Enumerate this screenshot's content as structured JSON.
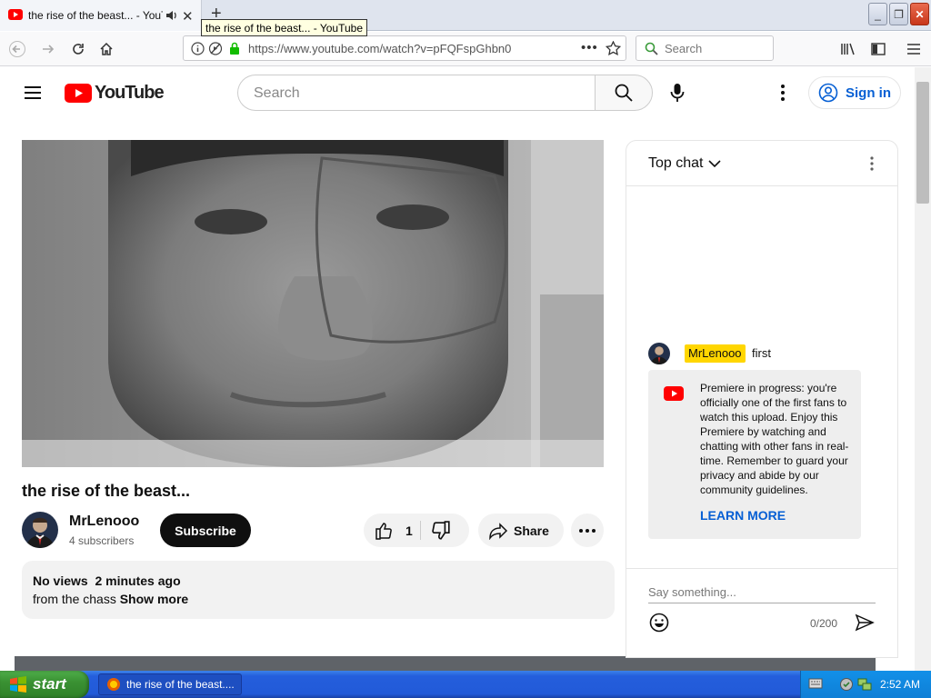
{
  "browser": {
    "tab_title": "the rise of the beast... - YouTube",
    "tooltip": "the rise of the beast... - YouTube",
    "url": "https://www.youtube.com/watch?v=pFQFspGhbn0",
    "search_placeholder": "Search"
  },
  "youtube": {
    "logo_text": "YouTube",
    "search_placeholder": "Search",
    "sign_in": "Sign in",
    "video": {
      "title": "the rise of the beast...",
      "channel": "MrLenooo",
      "subscribers": "4 subscribers",
      "subscribe_label": "Subscribe",
      "like_count": "1",
      "share_label": "Share",
      "views": "No views",
      "time_ago": "2 minutes ago",
      "description": "from the chass",
      "show_more": "Show more"
    },
    "chat": {
      "mode": "Top chat",
      "message": {
        "author": "MrLenooo",
        "text": "first"
      },
      "notice": "Premiere in progress: you're officially one of the first fans to watch this upload. Enjoy this Premiere by watching and chatting with other fans in real-time. Remember to guard your privacy and abide by our community guidelines.",
      "notice_link": "LEARN MORE",
      "input_placeholder": "Say something...",
      "char_count": "0/200"
    }
  },
  "taskbar": {
    "start": "start",
    "task_label": "the rise of the beast....",
    "clock": "2:52 AM"
  },
  "colors": {
    "youtube_red": "#ff0000",
    "link_blue": "#065fd4",
    "author_badge": "#ffd600"
  }
}
